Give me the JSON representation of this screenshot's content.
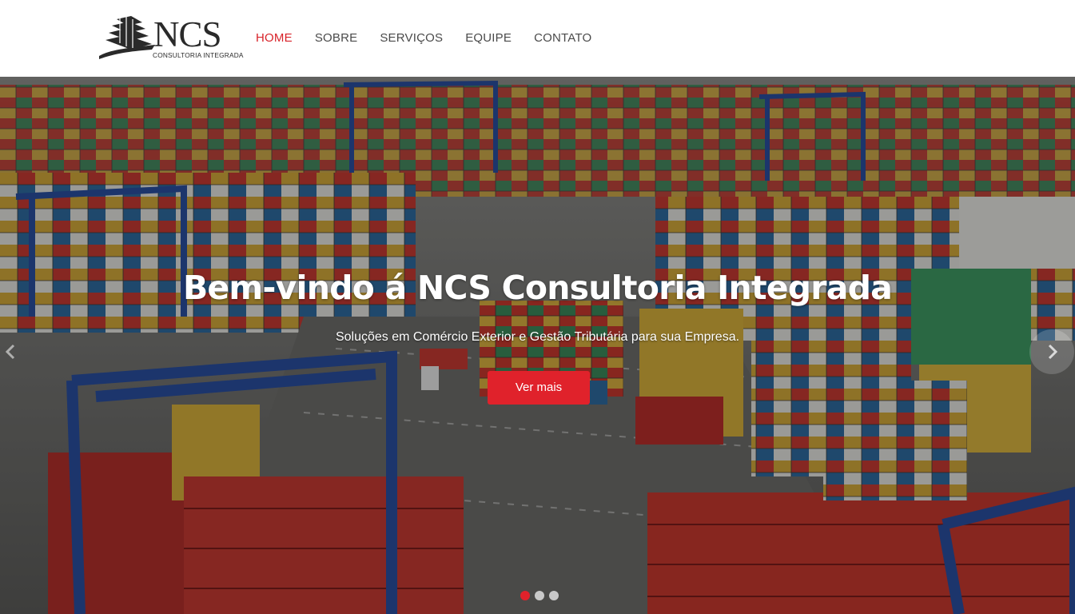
{
  "brand": {
    "name": "NCS",
    "tagline": "CONSULTORIA INTEGRADA",
    "logo_icon": "ship-hull-icon"
  },
  "nav": {
    "items": [
      {
        "label": "HOME",
        "active": true
      },
      {
        "label": "SOBRE",
        "active": false
      },
      {
        "label": "SERVIÇOS",
        "active": false
      },
      {
        "label": "EQUIPE",
        "active": false
      },
      {
        "label": "CONTATO",
        "active": false
      }
    ]
  },
  "hero": {
    "title": "Bem-vindo á NCS Consultoria Integrada",
    "subtitle": "Soluções em Comércio Exterior e Gestão Tributária para sua Empresa.",
    "button_label": "Ver mais",
    "background": "container-port-photo",
    "prev_icon": "chevron-left-icon",
    "next_icon": "chevron-right-icon",
    "slides_total": 3,
    "active_slide": 1
  },
  "colors": {
    "accent": "#e0222b",
    "nav_text": "#4a4a4a",
    "logo": "#2a2a2a"
  }
}
